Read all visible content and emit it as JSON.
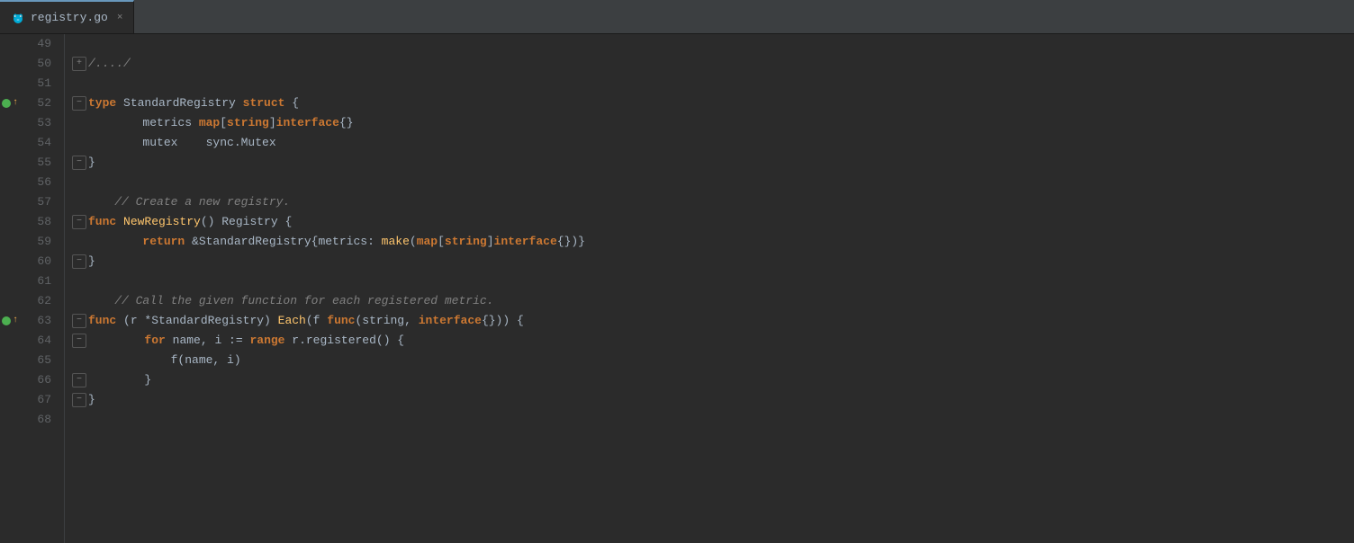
{
  "tab": {
    "icon": "go-gopher",
    "label": "registry.go",
    "close": "×"
  },
  "colors": {
    "background": "#2b2b2b",
    "tab_active": "#2b2b2b",
    "tab_inactive": "#3c3f41",
    "gutter_text": "#606366",
    "keyword": "#cc7832",
    "funcname": "#ffc66d",
    "comment": "#808080",
    "default": "#a9b7c6",
    "purple": "#9876aa",
    "green": "#4caf50"
  },
  "lines": [
    {
      "num": "49",
      "content": ""
    },
    {
      "num": "50",
      "content": "FOLD_DOTDOT"
    },
    {
      "num": "51",
      "content": ""
    },
    {
      "num": "52",
      "content": "TYPE_STANDARD_REGISTRY"
    },
    {
      "num": "53",
      "content": "METRICS_LINE"
    },
    {
      "num": "54",
      "content": "MUTEX_LINE"
    },
    {
      "num": "55",
      "content": "CLOSE_BRACE"
    },
    {
      "num": "56",
      "content": ""
    },
    {
      "num": "57",
      "content": "COMMENT_CREATE"
    },
    {
      "num": "58",
      "content": "FUNC_NEWREGISTRY"
    },
    {
      "num": "59",
      "content": "RETURN_LINE"
    },
    {
      "num": "60",
      "content": "CLOSE_BRACE_2"
    },
    {
      "num": "61",
      "content": ""
    },
    {
      "num": "62",
      "content": "COMMENT_CALL"
    },
    {
      "num": "63",
      "content": "FUNC_EACH"
    },
    {
      "num": "64",
      "content": "FOR_LINE"
    },
    {
      "num": "65",
      "content": "F_NAME_LINE"
    },
    {
      "num": "66",
      "content": "CLOSE_BRACE_3"
    },
    {
      "num": "67",
      "content": "CLOSE_BRACE_4"
    },
    {
      "num": "68",
      "content": ""
    }
  ]
}
